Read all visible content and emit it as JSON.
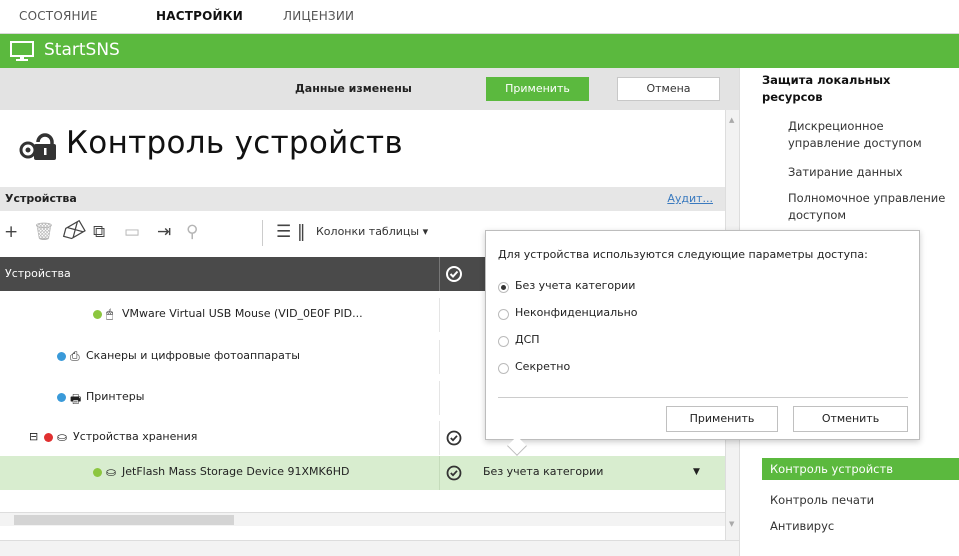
{
  "tabs": [
    {
      "label": "СОСТОЯНИЕ",
      "active": false
    },
    {
      "label": "НАСТРОЙКИ",
      "active": true
    },
    {
      "label": "ЛИЦЕНЗИИ",
      "active": false
    }
  ],
  "app": {
    "title": "StartSNS",
    "icon": "monitor-icon",
    "accent": "#5bb93e"
  },
  "actionbar": {
    "changed_text": "Данные изменены",
    "apply_label": "Применить",
    "cancel_label": "Отмена"
  },
  "page": {
    "title": "Контроль устройств",
    "icon": "lock-gear-icon"
  },
  "devices": {
    "section_label": "Устройства",
    "audit_link": "Аудит...",
    "columns_label": "Колонки таблицы ▾",
    "grid_header": "Устройства",
    "rows": [
      {
        "label": "VMware Virtual USB Mouse (VID_0E0F PID...",
        "status_color": "#8cc63f",
        "icon": "mouse-icon",
        "value": ""
      },
      {
        "label": "Сканеры и цифровые фотоаппараты",
        "status_color": "#3a9ad9",
        "icon": "scanner-icon",
        "value": ""
      },
      {
        "label": "Принтеры",
        "status_color": "#3a9ad9",
        "icon": "printer-icon",
        "value": ""
      },
      {
        "label": "Устройства хранения",
        "status_color": "#e03030",
        "icon": "storage-icon",
        "value": ""
      },
      {
        "label": "JetFlash Mass Storage Device 91XMK6HD",
        "status_color": "#8cc63f",
        "icon": "usb-drive-icon",
        "value": "Без учета категории"
      }
    ]
  },
  "popup": {
    "description": "Для устройства используются следующие параметры доступа:",
    "options": [
      {
        "label": "Без учета категории",
        "selected": true
      },
      {
        "label": "Неконфиденциально",
        "selected": false
      },
      {
        "label": "ДСП",
        "selected": false
      },
      {
        "label": "Секретно",
        "selected": false
      }
    ],
    "apply_label": "Применить",
    "cancel_label": "Отменить"
  },
  "rightnav": {
    "items": [
      {
        "label": "Защита локальных ресурсов",
        "kind": "group"
      },
      {
        "label": "Дискреционное управление доступом",
        "kind": "item"
      },
      {
        "label": "Затирание данных",
        "kind": "item"
      },
      {
        "label": "Полномочное управление доступом",
        "kind": "item"
      },
      {
        "label": "Контроль устройств",
        "kind": "active"
      },
      {
        "label": "Контроль печати",
        "kind": "item"
      },
      {
        "label": "Антивирус",
        "kind": "item"
      }
    ]
  }
}
